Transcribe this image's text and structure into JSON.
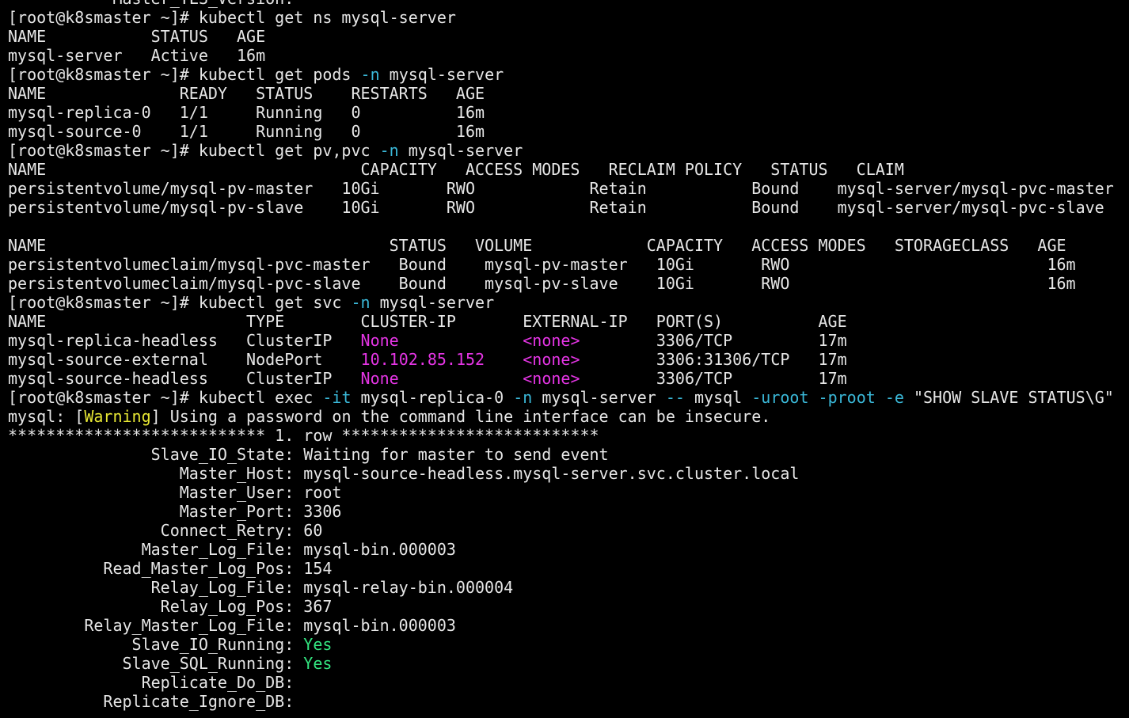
{
  "palette": {
    "fg": "#e6e6e6",
    "flag": "#3ab8d8",
    "magenta": "#e535e5",
    "yellow": "#e6e633",
    "green": "#33e680"
  },
  "terminal": {
    "lines": [
      [
        {
          "t": "           Master_TLS_Version:"
        }
      ],
      [
        {
          "t": "[root@k8smaster ~]# kubectl get ns mysql-server"
        }
      ],
      [
        {
          "t": "NAME           STATUS   AGE"
        }
      ],
      [
        {
          "t": "mysql-server   Active   16m"
        }
      ],
      [
        {
          "t": "[root@k8smaster ~]# kubectl get pods "
        },
        {
          "t": "-n",
          "c": "flag"
        },
        {
          "t": " mysql-server"
        }
      ],
      [
        {
          "t": "NAME              READY   STATUS    RESTARTS   AGE"
        }
      ],
      [
        {
          "t": "mysql-replica-0   1/1     Running   0          16m"
        }
      ],
      [
        {
          "t": "mysql-source-0    1/1     Running   0          16m"
        }
      ],
      [
        {
          "t": "[root@k8smaster ~]# kubectl get pv,pvc "
        },
        {
          "t": "-n",
          "c": "flag"
        },
        {
          "t": " mysql-server"
        }
      ],
      [
        {
          "t": "NAME                                 CAPACITY   ACCESS MODES   RECLAIM POLICY   STATUS   CLAIM"
        }
      ],
      [
        {
          "t": "persistentvolume/mysql-pv-master   10Gi       RWO            Retain           Bound    mysql-server/mysql-pvc-master"
        }
      ],
      [
        {
          "t": "persistentvolume/mysql-pv-slave    10Gi       RWO            Retain           Bound    mysql-server/mysql-pvc-slave"
        }
      ],
      [
        {
          "t": ""
        }
      ],
      [
        {
          "t": "NAME                                    STATUS   VOLUME            CAPACITY   ACCESS MODES   STORAGECLASS   AGE"
        }
      ],
      [
        {
          "t": "persistentvolumeclaim/mysql-pvc-master   Bound    mysql-pv-master   10Gi       RWO                           16m"
        }
      ],
      [
        {
          "t": "persistentvolumeclaim/mysql-pvc-slave    Bound    mysql-pv-slave    10Gi       RWO                           16m"
        }
      ],
      [
        {
          "t": "[root@k8smaster ~]# kubectl get svc "
        },
        {
          "t": "-n",
          "c": "flag"
        },
        {
          "t": " mysql-server"
        }
      ],
      [
        {
          "t": "NAME                     TYPE        CLUSTER-IP       EXTERNAL-IP   PORT(S)          AGE"
        }
      ],
      [
        {
          "t": "mysql-replica-headless   ClusterIP   "
        },
        {
          "t": "None",
          "c": "magenta"
        },
        {
          "t": "             "
        },
        {
          "t": "<none>",
          "c": "magenta"
        },
        {
          "t": "        3306/TCP         17m"
        }
      ],
      [
        {
          "t": "mysql-source-external    NodePort    "
        },
        {
          "t": "10.102.85.152",
          "c": "magenta"
        },
        {
          "t": "    "
        },
        {
          "t": "<none>",
          "c": "magenta"
        },
        {
          "t": "        3306:31306/TCP   17m"
        }
      ],
      [
        {
          "t": "mysql-source-headless    ClusterIP   "
        },
        {
          "t": "None",
          "c": "magenta"
        },
        {
          "t": "             "
        },
        {
          "t": "<none>",
          "c": "magenta"
        },
        {
          "t": "        3306/TCP         17m"
        }
      ],
      [
        {
          "t": "[root@k8smaster ~]# kubectl exec "
        },
        {
          "t": "-it",
          "c": "flag"
        },
        {
          "t": " mysql-replica-0 "
        },
        {
          "t": "-n",
          "c": "flag"
        },
        {
          "t": " mysql-server "
        },
        {
          "t": "--",
          "c": "flag"
        },
        {
          "t": " mysql "
        },
        {
          "t": "-uroot",
          "c": "flag"
        },
        {
          "t": " "
        },
        {
          "t": "-proot",
          "c": "flag"
        },
        {
          "t": " "
        },
        {
          "t": "-e",
          "c": "flag"
        },
        {
          "t": " \"SHOW SLAVE STATUS\\G\""
        }
      ],
      [
        {
          "t": "mysql: ["
        },
        {
          "t": "Warning",
          "c": "yellow"
        },
        {
          "t": "] Using a password on the command line interface can be insecure."
        }
      ],
      [
        {
          "t": "*************************** 1. row ***************************"
        }
      ],
      [
        {
          "t": "               Slave_IO_State: Waiting for master to send event"
        }
      ],
      [
        {
          "t": "                  Master_Host: mysql-source-headless.mysql-server.svc.cluster.local"
        }
      ],
      [
        {
          "t": "                  Master_User: root"
        }
      ],
      [
        {
          "t": "                  Master_Port: 3306"
        }
      ],
      [
        {
          "t": "                Connect_Retry: 60"
        }
      ],
      [
        {
          "t": "              Master_Log_File: mysql-bin.000003"
        }
      ],
      [
        {
          "t": "          Read_Master_Log_Pos: 154"
        }
      ],
      [
        {
          "t": "               Relay_Log_File: mysql-relay-bin.000004"
        }
      ],
      [
        {
          "t": "                Relay_Log_Pos: 367"
        }
      ],
      [
        {
          "t": "        Relay_Master_Log_File: mysql-bin.000003"
        }
      ],
      [
        {
          "t": "             Slave_IO_Running: "
        },
        {
          "t": "Yes",
          "c": "green"
        }
      ],
      [
        {
          "t": "            Slave_SQL_Running: "
        },
        {
          "t": "Yes",
          "c": "green"
        }
      ],
      [
        {
          "t": "              Replicate_Do_DB:"
        }
      ],
      [
        {
          "t": "          Replicate_Ignore_DB:"
        }
      ]
    ]
  }
}
